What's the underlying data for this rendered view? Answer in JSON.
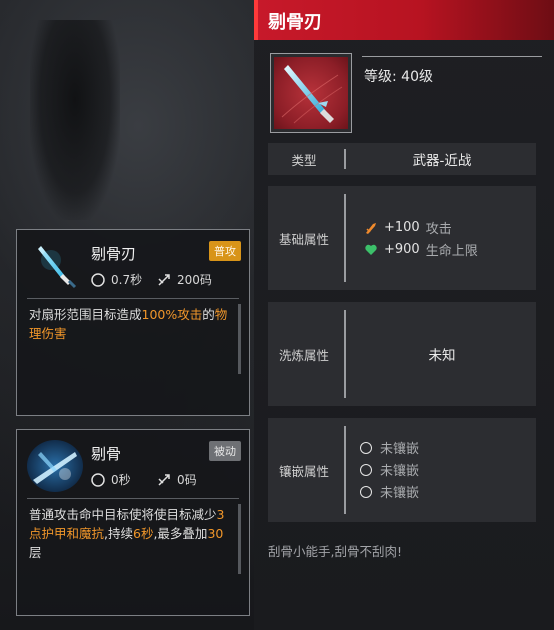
{
  "colors": {
    "accent_red": "#c7192a",
    "highlight_orange": "#f0962a",
    "tag_active": "#d89419",
    "tag_passive": "#6e7074",
    "attack_icon": "#f08a2c",
    "health_icon": "#3cc06a"
  },
  "skills": [
    {
      "name": "剔骨刃",
      "tag": "普攻",
      "cooldown": "0.7秒",
      "range": "200码",
      "icon": "blue-blade-icon",
      "desc": [
        {
          "text": "对扇形范围目标造成",
          "hl": false
        },
        {
          "text": "100%攻击",
          "hl": true
        },
        {
          "text": "的",
          "hl": false
        },
        {
          "text": "物理伤害",
          "hl": true
        }
      ]
    },
    {
      "name": "剔骨",
      "tag": "被动",
      "cooldown": "0秒",
      "range": "0码",
      "icon": "frost-slash-icon",
      "desc": [
        {
          "text": "普通攻击命中目标使将使目标减少",
          "hl": false
        },
        {
          "text": "3点护甲和魔抗",
          "hl": true
        },
        {
          "text": ",持续",
          "hl": false
        },
        {
          "text": "6秒",
          "hl": true
        },
        {
          "text": ",最多叠加",
          "hl": false
        },
        {
          "text": "30",
          "hl": true
        },
        {
          "text": "层",
          "hl": false
        }
      ]
    }
  ],
  "item": {
    "title": "剔骨刃",
    "level": "等级: 40级",
    "type_label": "类型",
    "type_value": "武器-近战",
    "base_label": "基础属性",
    "base_bonuses": [
      {
        "value": "+100",
        "name": "攻击",
        "icon": "attack-icon"
      },
      {
        "value": "+900",
        "name": "生命上限",
        "icon": "heart-icon"
      }
    ],
    "refine_label": "洗炼属性",
    "refine_value": "未知",
    "socket_label": "镶嵌属性",
    "sockets": [
      "未镶嵌",
      "未镶嵌",
      "未镶嵌"
    ],
    "flavor": "刮骨小能手,刮骨不刮肉!"
  }
}
